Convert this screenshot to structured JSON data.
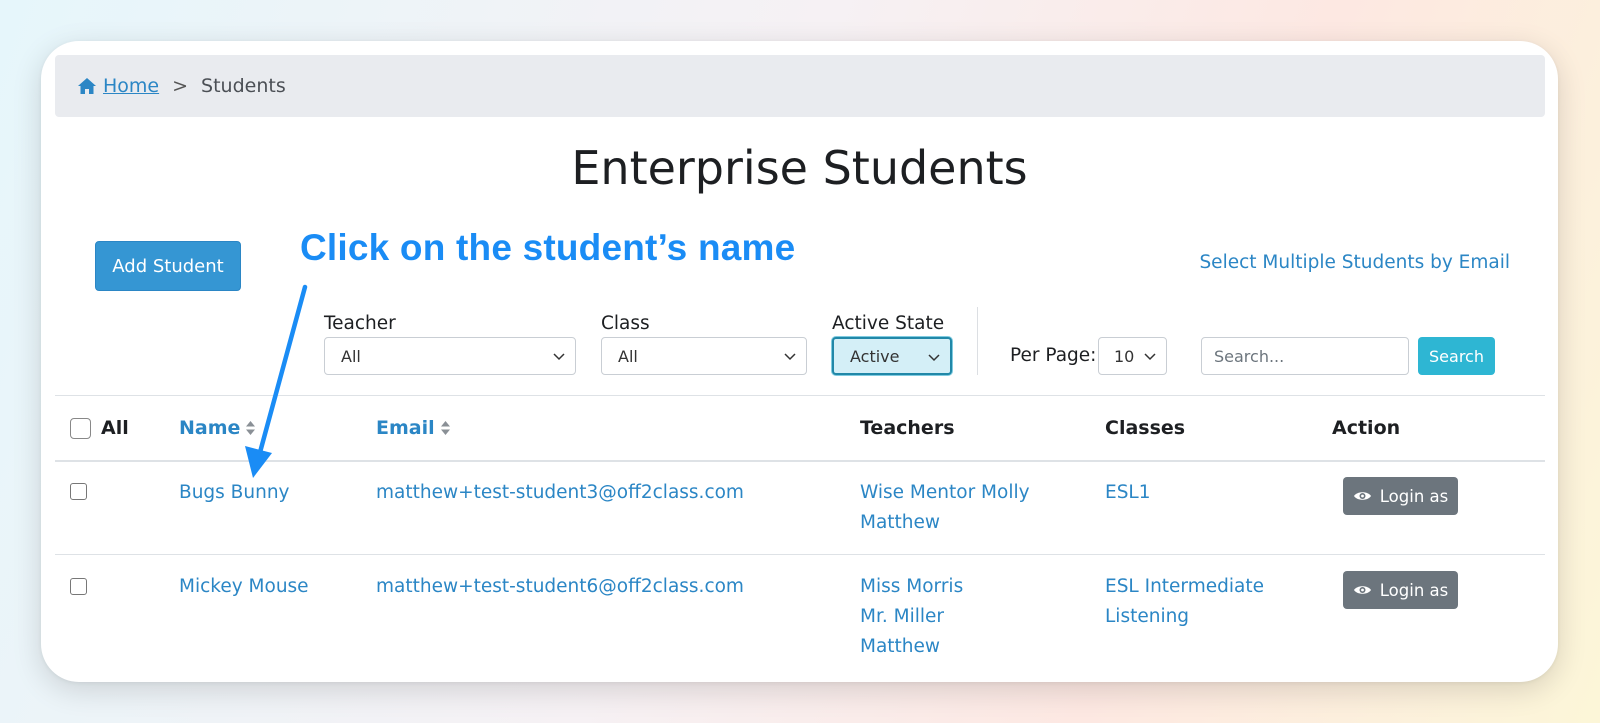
{
  "breadcrumb": {
    "home": "Home",
    "separator": ">",
    "current": "Students"
  },
  "page": {
    "title": "Enterprise Students"
  },
  "actions": {
    "add_student": "Add Student",
    "select_multiple": "Select Multiple Students by Email"
  },
  "annotation": {
    "callout": "Click on the student’s name"
  },
  "filters": {
    "teacher": {
      "label": "Teacher",
      "value": "All"
    },
    "class": {
      "label": "Class",
      "value": "All"
    },
    "active_state": {
      "label": "Active State",
      "value": "Active"
    },
    "per_page": {
      "label": "Per Page:",
      "value": "10"
    },
    "search": {
      "placeholder": "Search...",
      "button": "Search"
    }
  },
  "table": {
    "headers": {
      "all": "All",
      "name": "Name",
      "email": "Email",
      "teachers": "Teachers",
      "classes": "Classes",
      "action": "Action"
    },
    "rows": [
      {
        "name": "Bugs Bunny",
        "email": "matthew+test-student3@off2class.com",
        "teachers": [
          "Wise Mentor Molly",
          "Matthew"
        ],
        "classes": [
          "ESL1"
        ],
        "action": "Login as"
      },
      {
        "name": "Mickey Mouse",
        "email": "matthew+test-student6@off2class.com",
        "teachers": [
          "Miss Morris",
          "Mr. Miller",
          "Matthew"
        ],
        "classes": [
          "ESL Intermediate",
          "Listening"
        ],
        "action": "Login as"
      }
    ]
  },
  "colors": {
    "link": "#2b86c5",
    "primary": "#3596d3",
    "info": "#2eb6d3",
    "secondary": "#6c757d",
    "callout": "#1a8cf5"
  },
  "icons": {
    "home": "home-icon",
    "sort": "sort-icon",
    "chevron": "chevron-down-icon",
    "eye": "eye-icon",
    "arrow": "arrow-icon"
  }
}
